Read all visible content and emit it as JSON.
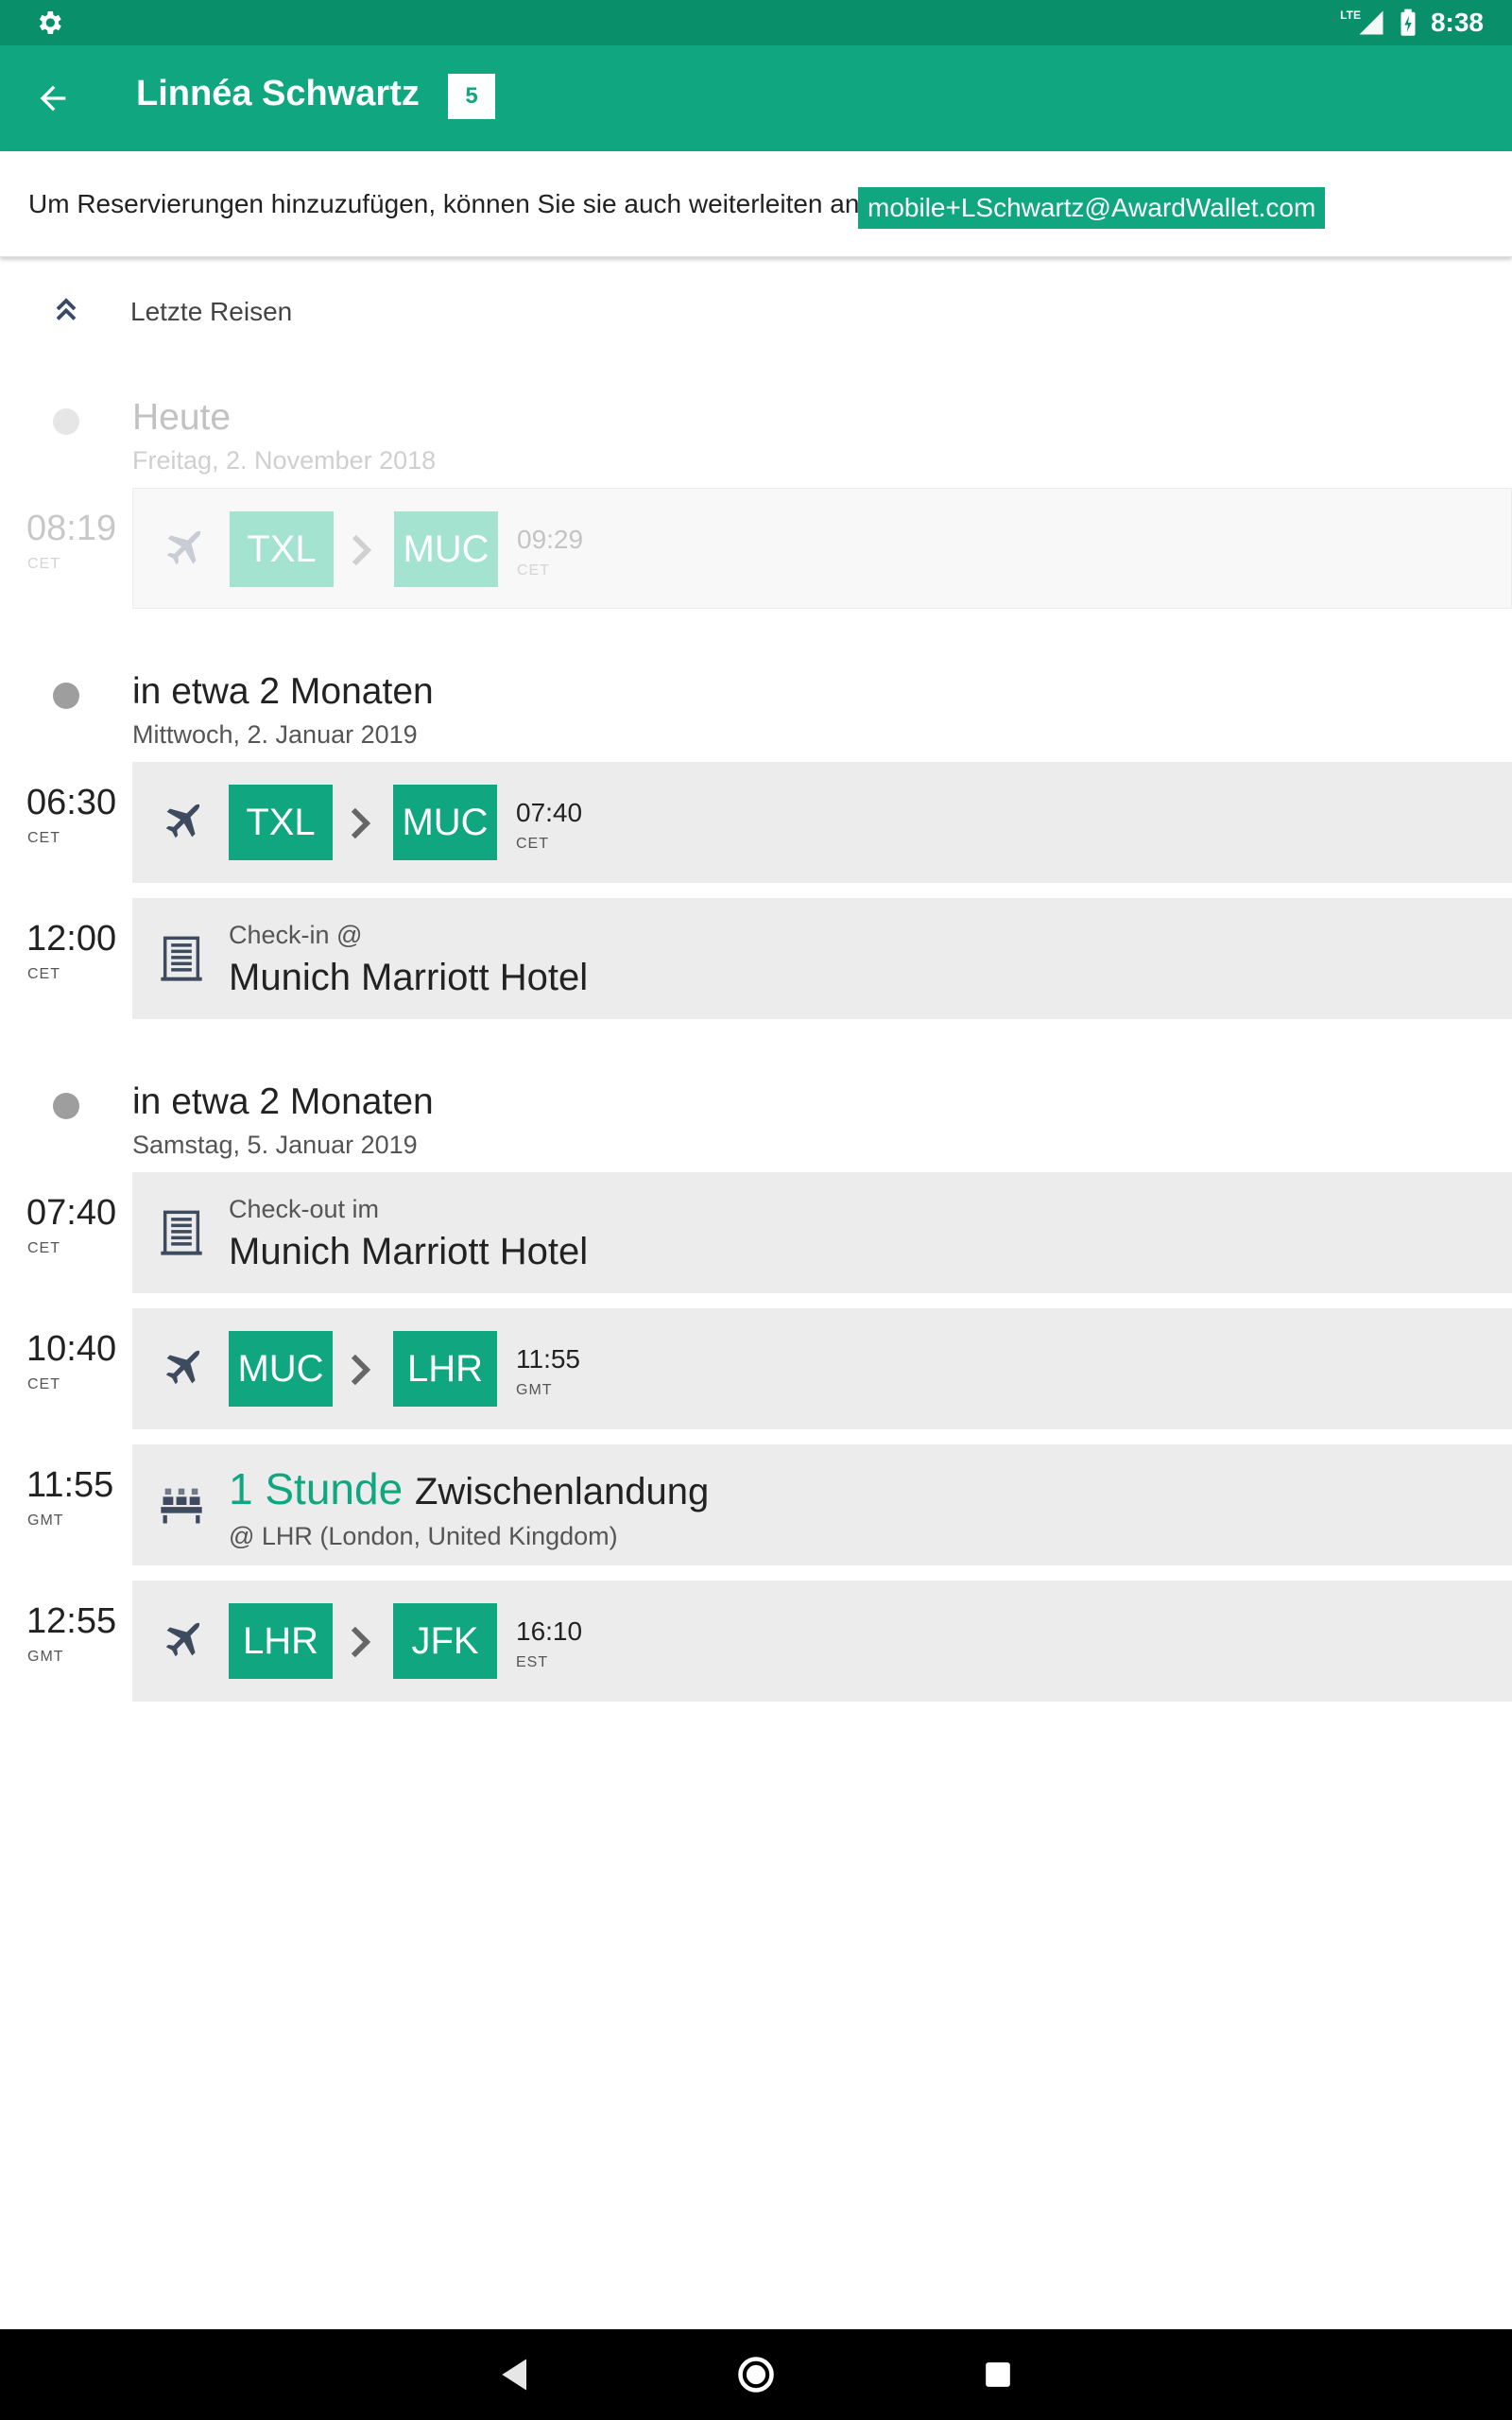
{
  "status_bar": {
    "time": "8:38",
    "network": "LTE",
    "icons": [
      "settings-icon",
      "signal-icon",
      "battery-charging-icon"
    ]
  },
  "app_bar": {
    "title": "Linnéa Schwartz",
    "count": "5"
  },
  "banner": {
    "text": "Um Reservierungen hinzuzufügen, können Sie sie auch weiterleiten an:",
    "email": "mobile+LSchwartz@AwardWallet.com"
  },
  "past_trips": {
    "label": "Letzte Reisen"
  },
  "days": [
    {
      "relative": "Heute",
      "date": "Freitag, 2. November 2018"
    },
    {
      "relative": "in etwa 2 Monaten",
      "date": "Mittwoch, 2. Januar 2019"
    },
    {
      "relative": "in etwa 2 Monaten",
      "date": "Samstag, 5. Januar 2019"
    }
  ],
  "segments": [
    {
      "type": "flight",
      "time": "08:19",
      "tz": "CET",
      "from": "TXL",
      "to": "MUC",
      "arrival_time": "09:29",
      "arrival_tz": "CET"
    },
    {
      "type": "flight",
      "time": "06:30",
      "tz": "CET",
      "from": "TXL",
      "to": "MUC",
      "arrival_time": "07:40",
      "arrival_tz": "CET"
    },
    {
      "type": "hotel",
      "time": "12:00",
      "tz": "CET",
      "subtitle": "Check-in @",
      "name": "Munich Marriott Hotel"
    },
    {
      "type": "hotel",
      "time": "07:40",
      "tz": "CET",
      "subtitle": "Check-out im",
      "name": "Munich Marriott Hotel"
    },
    {
      "type": "flight",
      "time": "10:40",
      "tz": "CET",
      "from": "MUC",
      "to": "LHR",
      "arrival_time": "11:55",
      "arrival_tz": "GMT"
    },
    {
      "type": "layover",
      "time": "11:55",
      "tz": "GMT",
      "duration": "1 Stunde",
      "label": "Zwischenlandung",
      "location": "@ LHR (London, United Kingdom)"
    },
    {
      "type": "flight",
      "time": "12:55",
      "tz": "GMT",
      "from": "LHR",
      "to": "JFK",
      "arrival_time": "16:10",
      "arrival_tz": "EST"
    }
  ],
  "colors": {
    "status_bar": "#0a8f6b",
    "app_bar": "#10a680",
    "accent": "#10a680",
    "card": "#ececec"
  }
}
